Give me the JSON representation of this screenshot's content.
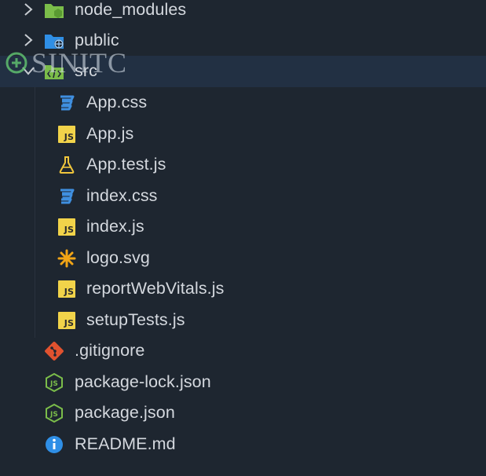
{
  "explorer": {
    "items": [
      {
        "label": "node_modules",
        "type": "folder",
        "icon": "node-folder-icon",
        "expanded": false
      },
      {
        "label": "public",
        "type": "folder",
        "icon": "globe-folder-icon",
        "expanded": false
      },
      {
        "label": "src",
        "type": "folder",
        "icon": "src-folder-icon",
        "expanded": true,
        "selected": true
      },
      {
        "label": "App.css",
        "type": "file",
        "icon": "css-icon"
      },
      {
        "label": "App.js",
        "type": "file",
        "icon": "js-icon"
      },
      {
        "label": "App.test.js",
        "type": "file",
        "icon": "flask-icon"
      },
      {
        "label": "index.css",
        "type": "file",
        "icon": "css-icon"
      },
      {
        "label": "index.js",
        "type": "file",
        "icon": "js-icon"
      },
      {
        "label": "logo.svg",
        "type": "file",
        "icon": "asterisk-icon"
      },
      {
        "label": "reportWebVitals.js",
        "type": "file",
        "icon": "js-icon"
      },
      {
        "label": "setupTests.js",
        "type": "file",
        "icon": "js-icon"
      },
      {
        "label": ".gitignore",
        "type": "file",
        "icon": "git-icon"
      },
      {
        "label": "package-lock.json",
        "type": "file",
        "icon": "nodejs-icon"
      },
      {
        "label": "package.json",
        "type": "file",
        "icon": "nodejs-icon"
      },
      {
        "label": "README.md",
        "type": "file",
        "icon": "info-icon"
      }
    ],
    "js_badge": "JS"
  },
  "watermark": {
    "text": "SINITC"
  },
  "colors": {
    "background": "#1e2630",
    "selected_row": "#223043",
    "css_blue": "#3f8fe0",
    "js_yellow": "#f1d34a",
    "flask_yellow": "#f0c63c",
    "svg_orange": "#f2a516",
    "git_red": "#e0522f",
    "node_green": "#7bbd4a",
    "info_blue": "#2f8fe6"
  }
}
